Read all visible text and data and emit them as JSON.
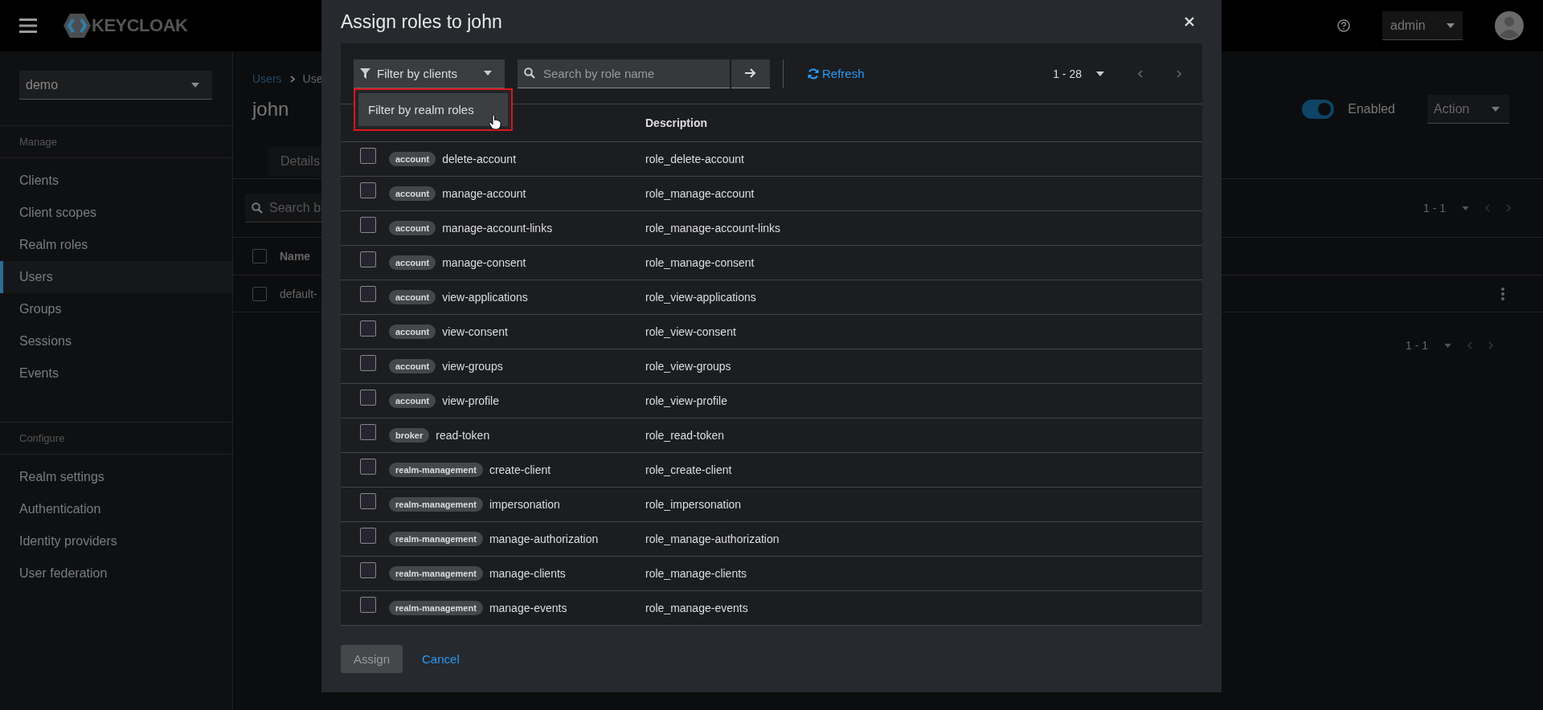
{
  "header": {
    "logo": "KEYCLOAK",
    "user_menu": "admin"
  },
  "sidebar": {
    "realm_select": "demo",
    "sections": [
      {
        "title": "Manage",
        "items": [
          {
            "label": "Clients",
            "selected": false
          },
          {
            "label": "Client scopes",
            "selected": false
          },
          {
            "label": "Realm roles",
            "selected": false
          },
          {
            "label": "Users",
            "selected": true
          },
          {
            "label": "Groups",
            "selected": false
          },
          {
            "label": "Sessions",
            "selected": false
          },
          {
            "label": "Events",
            "selected": false
          }
        ]
      },
      {
        "title": "Configure",
        "items": [
          {
            "label": "Realm settings",
            "selected": false
          },
          {
            "label": "Authentication",
            "selected": false
          },
          {
            "label": "Identity providers",
            "selected": false
          },
          {
            "label": "User federation",
            "selected": false
          }
        ]
      }
    ]
  },
  "page": {
    "breadcrumb": [
      "Users",
      "Use"
    ],
    "title": "john",
    "enabled": {
      "label": "Enabled",
      "on": true
    },
    "action_menu": "Action",
    "tabs": [
      {
        "label": "Details",
        "selected": true
      }
    ],
    "search": {
      "placeholder": "Search b"
    },
    "pagination_top": "1 - 1",
    "pagination_bottom": "1 - 1",
    "table": {
      "columns": [
        "Name"
      ],
      "header_checked": false,
      "rows": [
        {
          "name": "default-",
          "checked": false
        }
      ]
    }
  },
  "dialog": {
    "title": "Assign roles to john",
    "filter": "Filter by clients",
    "filter_menu": [
      "Filter by realm roles"
    ],
    "search": {
      "placeholder": "Search by role name"
    },
    "refresh": "Refresh",
    "pagination": "1 - 28",
    "columns": [
      "Description"
    ],
    "rows": [
      {
        "client": "account",
        "role": "delete-account",
        "description": "role_delete-account",
        "checked": false
      },
      {
        "client": "account",
        "role": "manage-account",
        "description": "role_manage-account",
        "checked": false
      },
      {
        "client": "account",
        "role": "manage-account-links",
        "description": "role_manage-account-links",
        "checked": false
      },
      {
        "client": "account",
        "role": "manage-consent",
        "description": "role_manage-consent",
        "checked": false
      },
      {
        "client": "account",
        "role": "view-applications",
        "description": "role_view-applications",
        "checked": false
      },
      {
        "client": "account",
        "role": "view-consent",
        "description": "role_view-consent",
        "checked": false
      },
      {
        "client": "account",
        "role": "view-groups",
        "description": "role_view-groups",
        "checked": false
      },
      {
        "client": "account",
        "role": "view-profile",
        "description": "role_view-profile",
        "checked": false
      },
      {
        "client": "broker",
        "role": "read-token",
        "description": "role_read-token",
        "checked": false
      },
      {
        "client": "realm-management",
        "role": "create-client",
        "description": "role_create-client",
        "checked": false
      },
      {
        "client": "realm-management",
        "role": "impersonation",
        "description": "role_impersonation",
        "checked": false
      },
      {
        "client": "realm-management",
        "role": "manage-authorization",
        "description": "role_manage-authorization",
        "checked": false
      },
      {
        "client": "realm-management",
        "role": "manage-clients",
        "description": "role_manage-clients",
        "checked": false
      },
      {
        "client": "realm-management",
        "role": "manage-events",
        "description": "role_manage-events",
        "checked": false
      }
    ],
    "assign": {
      "label": "Assign",
      "disabled": true
    },
    "cancel": "Cancel"
  }
}
